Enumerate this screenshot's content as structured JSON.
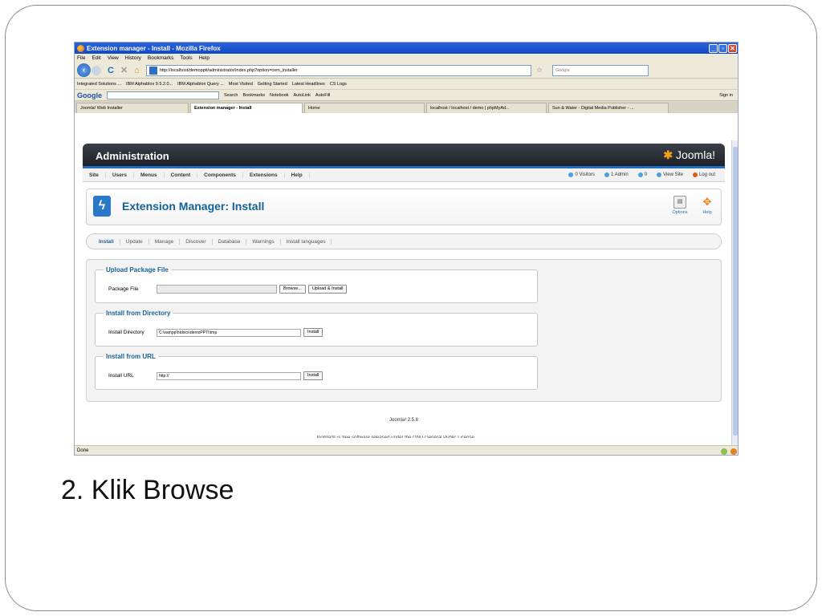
{
  "browser": {
    "window_title": "Extension manager - Install - Mozilla Firefox",
    "menu": [
      "File",
      "Edit",
      "View",
      "History",
      "Bookmarks",
      "Tools",
      "Help"
    ],
    "url": "http://localhost/demoppti/administrator/index.php?option=com_installer",
    "search_placeholder": "Google",
    "bookmarks": [
      "Integrated Solutions ...",
      "IBM Alphablox 9.5.2.0...",
      "IBM Alphablox Query ...",
      "Most Visited",
      "Getting Started",
      "Latest Headlines",
      "CS Logs"
    ],
    "google_toolbar": {
      "logo": "Google",
      "items": [
        "Search",
        "Bookmarks",
        "Notebook",
        "AutoLink",
        "AutoFill",
        "Sign in"
      ]
    },
    "tabs": [
      "Joomla! Web Installer",
      "Extension manager - Install",
      "Home",
      "localhost / localhost / demo | phpMyAd...",
      "Sun & Water - Digital Media Publisher - ..."
    ],
    "status": "Done"
  },
  "joomla": {
    "header_title": "Administration",
    "logo_text": "Joomla!",
    "menu": [
      "Site",
      "Users",
      "Menus",
      "Content",
      "Components",
      "Extensions",
      "Help"
    ],
    "status": {
      "visitors": "0 Visitors",
      "admin": "1 Admin",
      "messages": "0",
      "view_site": "View Site",
      "logout": "Log out"
    },
    "page_title": "Extension Manager: Install",
    "toolbar": {
      "options": "Options",
      "help": "Help"
    },
    "subnav": [
      "Install",
      "Update",
      "Manage",
      "Discover",
      "Database",
      "Warnings",
      "Install languages"
    ],
    "upload": {
      "legend": "Upload Package File",
      "label": "Package File",
      "browse": "Browse...",
      "submit": "Upload & Install"
    },
    "directory": {
      "legend": "Install from Directory",
      "label": "Install Directory",
      "value": "C:\\xampp\\htdocs\\demoPPTI\\tmp",
      "submit": "Install"
    },
    "url": {
      "legend": "Install from URL",
      "label": "Install URL",
      "value": "http://",
      "submit": "Install"
    },
    "footer": "Joomla! 2.5.8",
    "footer_license": "Joomla!® is free software released under the GNU General Public License."
  },
  "caption": "2. Klik Browse"
}
